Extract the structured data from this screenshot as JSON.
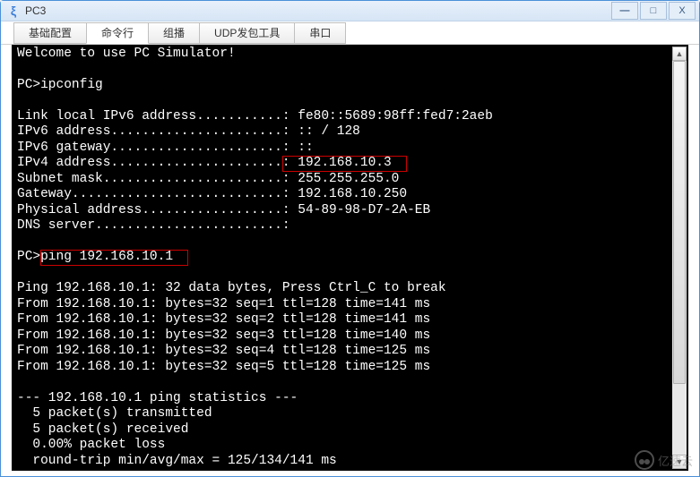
{
  "window": {
    "title": "PC3",
    "icon_glyph": "ξ"
  },
  "tabs": [
    {
      "label": "基础配置",
      "active": false
    },
    {
      "label": "命令行",
      "active": true
    },
    {
      "label": "组播",
      "active": false
    },
    {
      "label": "UDP发包工具",
      "active": false
    },
    {
      "label": "串口",
      "active": false
    }
  ],
  "terminal": {
    "lines": [
      "Welcome to use PC Simulator!",
      "",
      "PC>ipconfig",
      "",
      "Link local IPv6 address...........: fe80::5689:98ff:fed7:2aeb",
      "IPv6 address......................: :: / 128",
      "IPv6 gateway......................: ::",
      "IPv4 address......................: 192.168.10.3",
      "Subnet mask.......................: 255.255.255.0",
      "Gateway...........................: 192.168.10.250",
      "Physical address..................: 54-89-98-D7-2A-EB",
      "DNS server........................:",
      "",
      "PC>ping 192.168.10.1",
      "",
      "Ping 192.168.10.1: 32 data bytes, Press Ctrl_C to break",
      "From 192.168.10.1: bytes=32 seq=1 ttl=128 time=141 ms",
      "From 192.168.10.1: bytes=32 seq=2 ttl=128 time=141 ms",
      "From 192.168.10.1: bytes=32 seq=3 ttl=128 time=140 ms",
      "From 192.168.10.1: bytes=32 seq=4 ttl=128 time=125 ms",
      "From 192.168.10.1: bytes=32 seq=5 ttl=128 time=125 ms",
      "",
      "--- 192.168.10.1 ping statistics ---",
      "  5 packet(s) transmitted",
      "  5 packet(s) received",
      "  0.00% packet loss",
      "  round-trip min/avg/max = 125/134/141 ms"
    ],
    "highlights": [
      {
        "line_index": 7,
        "col_start": 34,
        "col_end": 50
      },
      {
        "line_index": 13,
        "col_start": 3,
        "col_end": 22
      }
    ]
  },
  "watermark": {
    "text": "亿速云"
  }
}
